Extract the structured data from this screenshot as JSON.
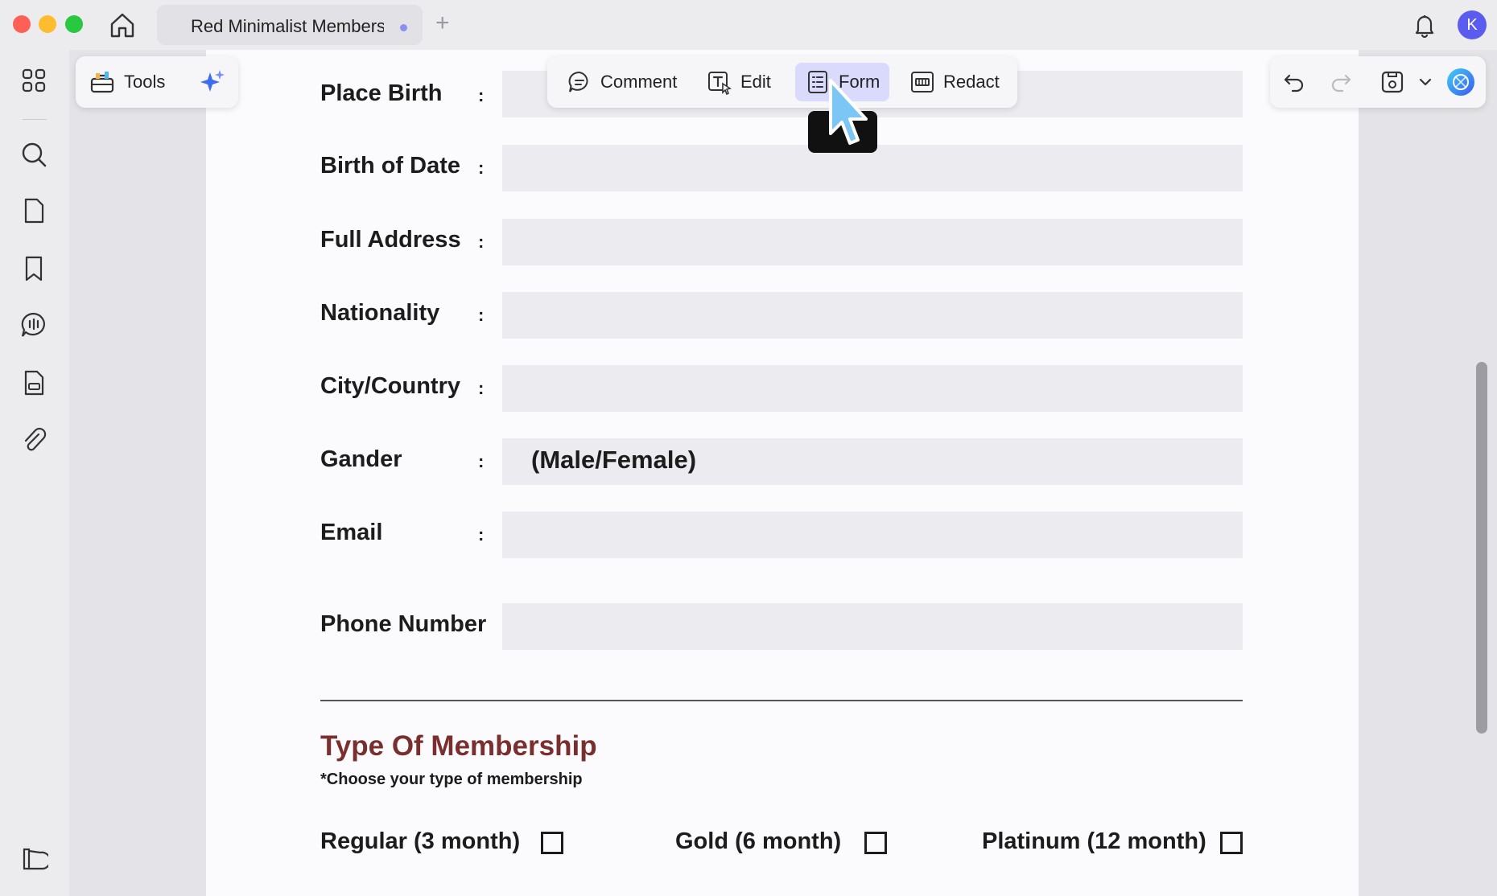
{
  "window": {
    "tab_title": "Red Minimalist Members",
    "new_tab": "+",
    "avatar_initial": "K"
  },
  "toolbar": {
    "tools_label": "Tools",
    "modes": [
      {
        "label": "Comment",
        "icon": "comment-icon"
      },
      {
        "label": "Edit",
        "icon": "edit-text-icon"
      },
      {
        "label": "Form",
        "icon": "form-icon",
        "active": true
      },
      {
        "label": "Redact",
        "icon": "redact-icon"
      }
    ]
  },
  "sidebar": {
    "icons": [
      "thumbnails-icon",
      "search-icon",
      "page-icon",
      "bookmark-icon",
      "comment-list-icon",
      "document-icon",
      "attachment-icon",
      "reading-mode-icon"
    ]
  },
  "form": {
    "fields": [
      {
        "label": "Place Birth",
        "colon": ":",
        "value": ""
      },
      {
        "label": "Birth of Date",
        "colon": ":",
        "value": ""
      },
      {
        "label": "Full Address",
        "colon": ":",
        "value": ""
      },
      {
        "label": "Nationality",
        "colon": ":",
        "value": ""
      },
      {
        "label": "City/Country",
        "colon": ":",
        "value": ""
      },
      {
        "label": "Gander",
        "colon": ":",
        "value": "(Male/Female)"
      },
      {
        "label": "Email",
        "colon": ":",
        "value": ""
      },
      {
        "label": "Phone Number",
        "colon": "",
        "value": ""
      }
    ],
    "membership": {
      "title": "Type Of Membership",
      "subtitle": "*Choose your type of membership",
      "options": [
        {
          "label": "Regular (3 month)",
          "checked": false
        },
        {
          "label": "Gold (6 month)",
          "checked": false
        },
        {
          "label": "Platinum (12 month)",
          "checked": false
        }
      ]
    }
  },
  "colors": {
    "accent": "#5a5cf0",
    "section_title": "#7a2f2f",
    "active_mode_bg": "#d9dafc"
  }
}
